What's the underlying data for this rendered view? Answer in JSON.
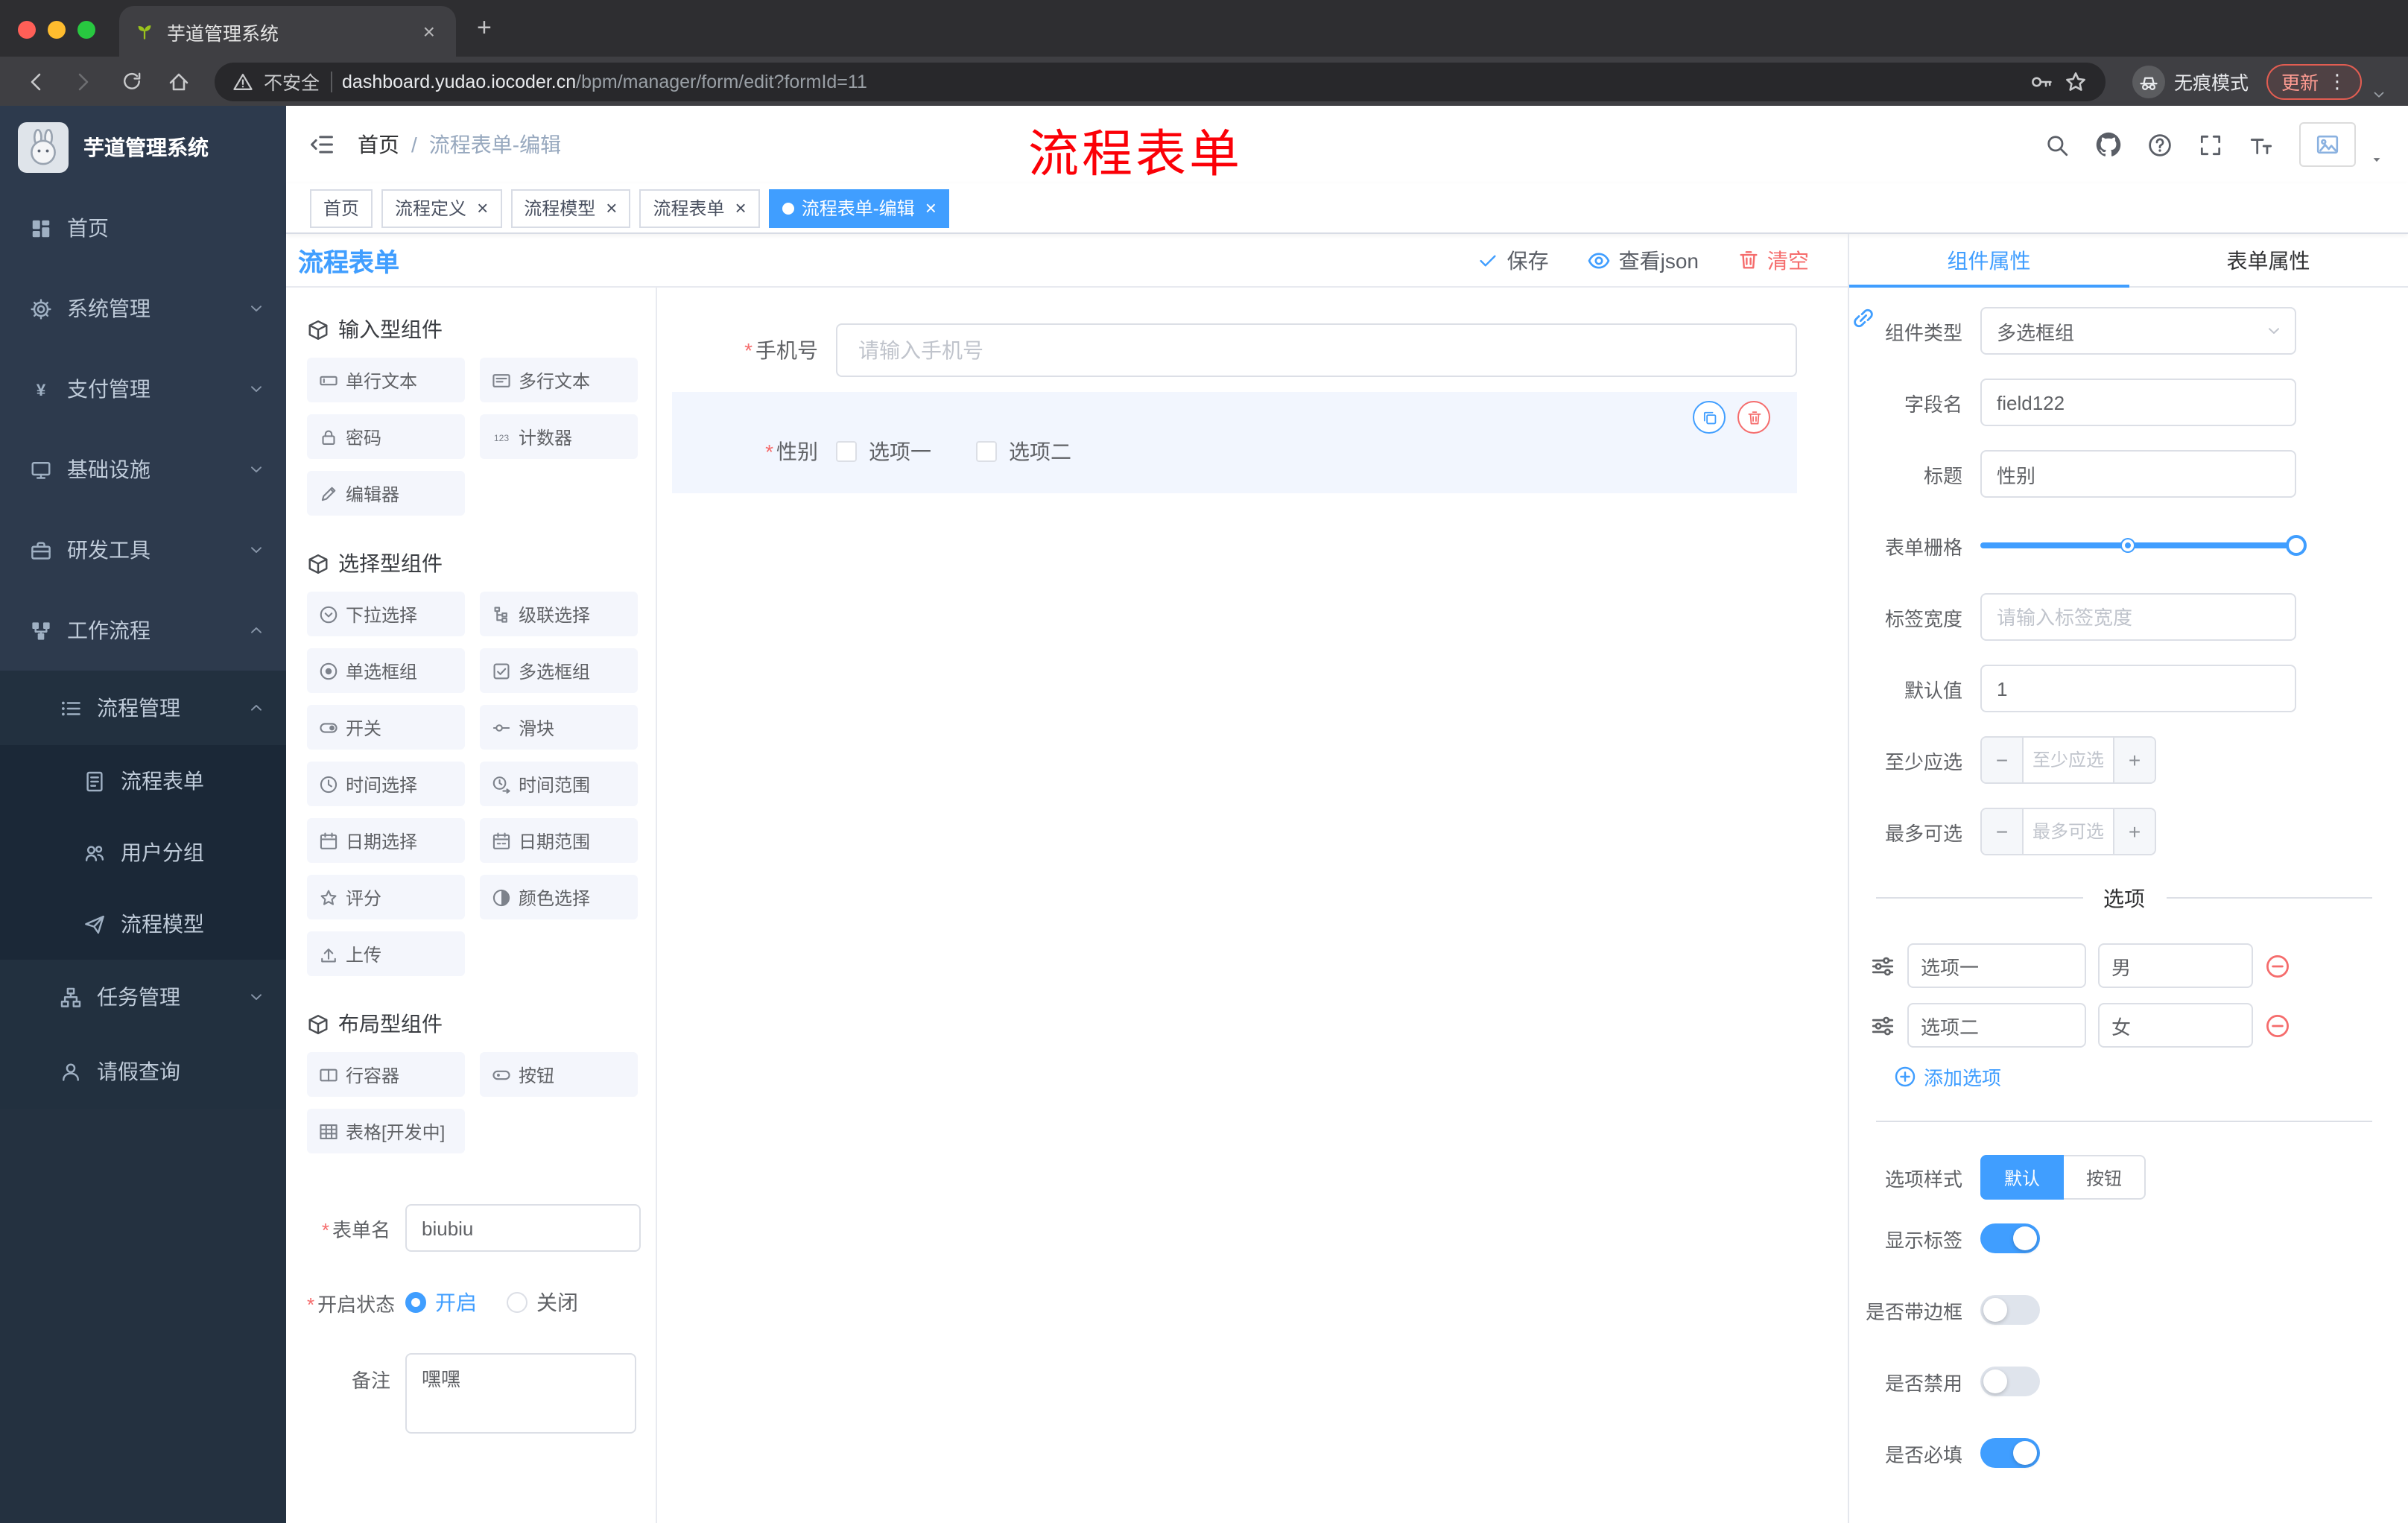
{
  "colors": {
    "accent": "#409eff",
    "danger": "#f56c6c"
  },
  "browser": {
    "tab": {
      "title": "芋道管理系统"
    },
    "address": {
      "security": "不安全",
      "domain": "dashboard.yudao.iocoder.cn",
      "path": "/bpm/manager/form/edit?formId=11"
    },
    "incognito": "无痕模式",
    "update": "更新"
  },
  "sidebar": {
    "logo": "芋道管理系统",
    "items": [
      {
        "label": "首页"
      },
      {
        "label": "系统管理"
      },
      {
        "label": "支付管理"
      },
      {
        "label": "基础设施"
      },
      {
        "label": "研发工具"
      },
      {
        "label": "工作流程"
      },
      {
        "label": "流程管理"
      },
      {
        "label": "流程表单"
      },
      {
        "label": "用户分组"
      },
      {
        "label": "流程模型"
      },
      {
        "label": "任务管理"
      },
      {
        "label": "请假查询"
      }
    ]
  },
  "header": {
    "breadcrumb_home": "首页",
    "breadcrumb_separator": "/",
    "breadcrumb_current": "流程表单-编辑",
    "annotation": "流程表单"
  },
  "tags": [
    {
      "label": "首页"
    },
    {
      "label": "流程定义"
    },
    {
      "label": "流程模型"
    },
    {
      "label": "流程表单"
    },
    {
      "label": "流程表单-编辑"
    }
  ],
  "designer": {
    "panel_title": "流程表单",
    "save": "保存",
    "view_json": "查看json",
    "clear": "清空",
    "sections": {
      "input_title": "输入型组件",
      "input_items": [
        "单行文本",
        "多行文本",
        "密码",
        "计数器",
        "编辑器"
      ],
      "select_title": "选择型组件",
      "select_items": [
        "下拉选择",
        "级联选择",
        "单选框组",
        "多选框组",
        "开关",
        "滑块",
        "时间选择",
        "时间范围",
        "日期选择",
        "日期范围",
        "评分",
        "颜色选择",
        "上传"
      ],
      "layout_title": "布局型组件",
      "layout_items": [
        "行容器",
        "按钮",
        "表格[开发中]"
      ]
    },
    "meta": {
      "form_name_label": "表单名",
      "form_name_value": "biubiu",
      "status_label": "开启状态",
      "status_on": "开启",
      "status_off": "关闭",
      "remark_label": "备注",
      "remark_value": "嘿嘿"
    },
    "canvas": {
      "phone_label": "手机号",
      "phone_placeholder": "请输入手机号",
      "gender_label": "性别",
      "gender_opt1": "选项一",
      "gender_opt2": "选项二"
    },
    "props": {
      "tab_component": "组件属性",
      "tab_form": "表单属性",
      "type_label": "组件类型",
      "type_value": "多选框组",
      "field_label": "字段名",
      "field_value": "field122",
      "title_label": "标题",
      "title_value": "性别",
      "grid_label": "表单栅格",
      "width_label": "标签宽度",
      "width_placeholder": "请输入标签宽度",
      "default_label": "默认值",
      "default_value": "1",
      "min_label": "至少应选",
      "min_placeholder": "至少应选",
      "max_label": "最多可选",
      "max_placeholder": "最多可选",
      "options_title": "选项",
      "options": [
        {
          "label": "选项一",
          "value": "男"
        },
        {
          "label": "选项二",
          "value": "女"
        }
      ],
      "add_option": "添加选项",
      "style_label": "选项样式",
      "style_default": "默认",
      "style_button": "按钮",
      "switch_show_label": "显示标签",
      "switch_border_label": "是否带边框",
      "switch_disabled_label": "是否禁用",
      "switch_required_label": "是否必填"
    }
  }
}
